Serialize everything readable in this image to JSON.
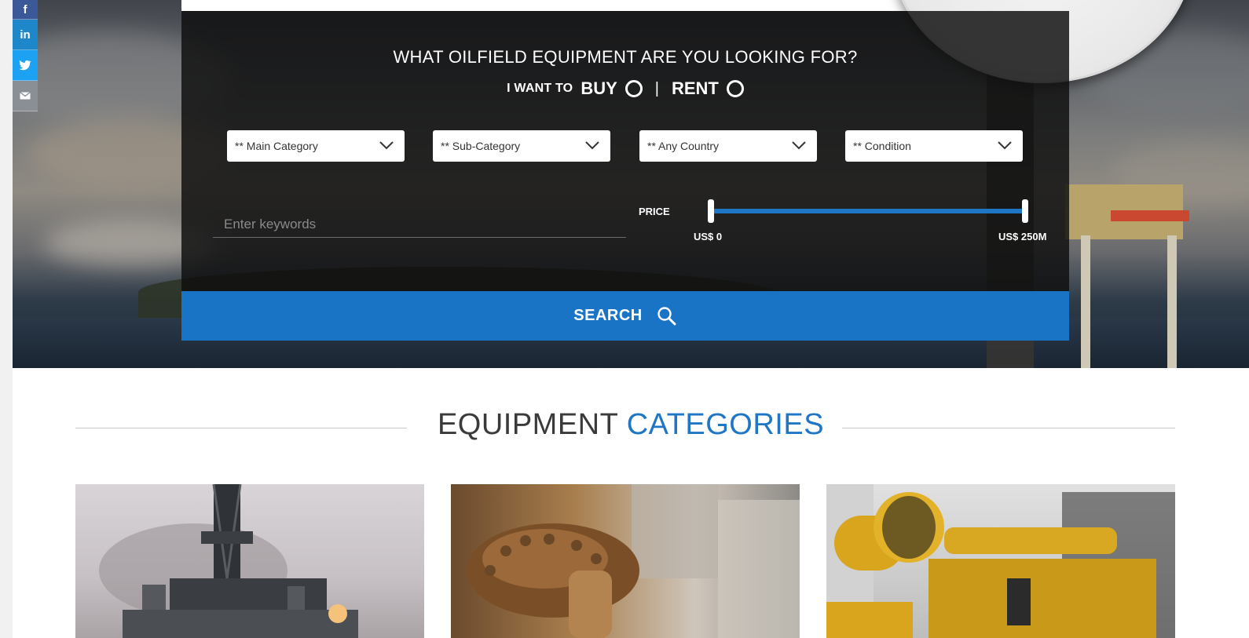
{
  "social": [
    "f",
    "in",
    "twitter-icon",
    "mail-icon"
  ],
  "search": {
    "question": "WHAT OILFIELD EQUIPMENT ARE YOU LOOKING FOR?",
    "mode_prefix": "I WANT TO",
    "mode_buy": "BUY",
    "mode_separator": "|",
    "mode_rent": "RENT",
    "selects": [
      {
        "label": "** Main Category"
      },
      {
        "label": "** Sub-Category"
      },
      {
        "label": "** Any Country"
      },
      {
        "label": "** Condition"
      }
    ],
    "keywords_placeholder": "Enter keywords",
    "price_label": "PRICE",
    "price_min": "US$ 0",
    "price_max": "US$ 250M",
    "price_range_selected": [
      0,
      1
    ],
    "button_label": "SEARCH"
  },
  "categories": {
    "heading_part1": "EQUIPMENT",
    "heading_part2": "CATEGORIES"
  },
  "colors": {
    "accent": "#1a74c6",
    "heading_dark": "#3a3a3a",
    "facebook": "#3b5998",
    "linkedin": "#1d87c9",
    "twitter": "#1da1f2",
    "mail": "#8a8f96"
  }
}
